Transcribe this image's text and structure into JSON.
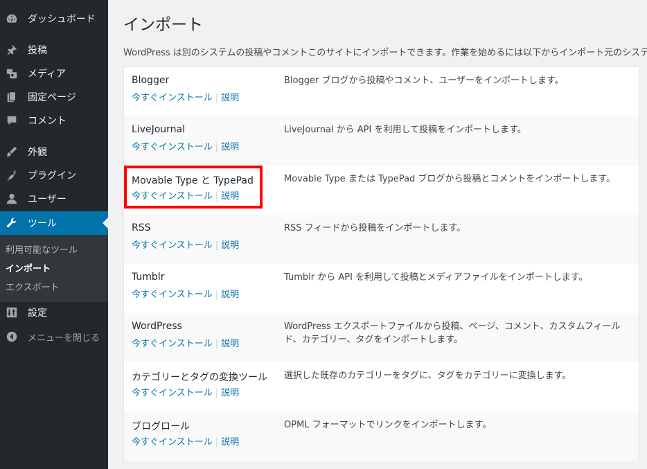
{
  "sidebar": {
    "items": [
      {
        "label": "ダッシュボード",
        "icon": "dashboard-icon"
      },
      {
        "label": "投稿",
        "icon": "pin-icon"
      },
      {
        "label": "メディア",
        "icon": "media-icon"
      },
      {
        "label": "固定ページ",
        "icon": "page-icon"
      },
      {
        "label": "コメント",
        "icon": "comment-icon"
      },
      {
        "label": "外観",
        "icon": "appearance-icon"
      },
      {
        "label": "プラグイン",
        "icon": "plugin-icon"
      },
      {
        "label": "ユーザー",
        "icon": "user-icon"
      },
      {
        "label": "ツール",
        "icon": "wrench-icon"
      },
      {
        "label": "設定",
        "icon": "settings-icon"
      }
    ],
    "submenu": [
      "利用可能なツール",
      "インポート",
      "エクスポート"
    ],
    "collapse_label": "メニューを閉じる",
    "active_color": "#0073aa"
  },
  "page": {
    "title": "インポート",
    "intro": "WordPress は別のシステムの投稿やコメントこのサイトにインポートできます。作業を始めるには以下からインポート元のシステ"
  },
  "importers": [
    {
      "name": "Blogger",
      "install": "今すぐインストール",
      "details": "説明",
      "desc": "Blogger ブログから投稿やコメント、ユーザーをインポートします。"
    },
    {
      "name": "LiveJournal",
      "install": "今すぐインストール",
      "details": "説明",
      "desc": "LiveJournal から API を利用して投稿をインポートします。"
    },
    {
      "name": "Movable Type と TypePad",
      "install": "今すぐインストール",
      "details": "説明",
      "desc": "Movable Type または TypePad ブログから投稿とコメントをインポートします。"
    },
    {
      "name": "RSS",
      "install": "今すぐインストール",
      "details": "説明",
      "desc": "RSS フィードから投稿をインポートします。"
    },
    {
      "name": "Tumblr",
      "install": "今すぐインストール",
      "details": "説明",
      "desc": "Tumblr から API を利用して投稿とメディアファイルをインポートします。"
    },
    {
      "name": "WordPress",
      "install": "今すぐインストール",
      "details": "説明",
      "desc": "WordPress エクスポートファイルから投稿、ページ、コメント、カスタムフィールド、カテゴリー、タグをインポートします。"
    },
    {
      "name": "カテゴリーとタグの変換ツール",
      "install": "今すぐインストール",
      "details": "説明",
      "desc": "選択した既存のカテゴリーをタグに、タグをカテゴリーに変換します。"
    },
    {
      "name": "ブログロール",
      "install": "今すぐインストール",
      "details": "説明",
      "desc": "OPML フォーマットでリンクをインポートします。"
    }
  ],
  "highlight_color": "#ff0000"
}
